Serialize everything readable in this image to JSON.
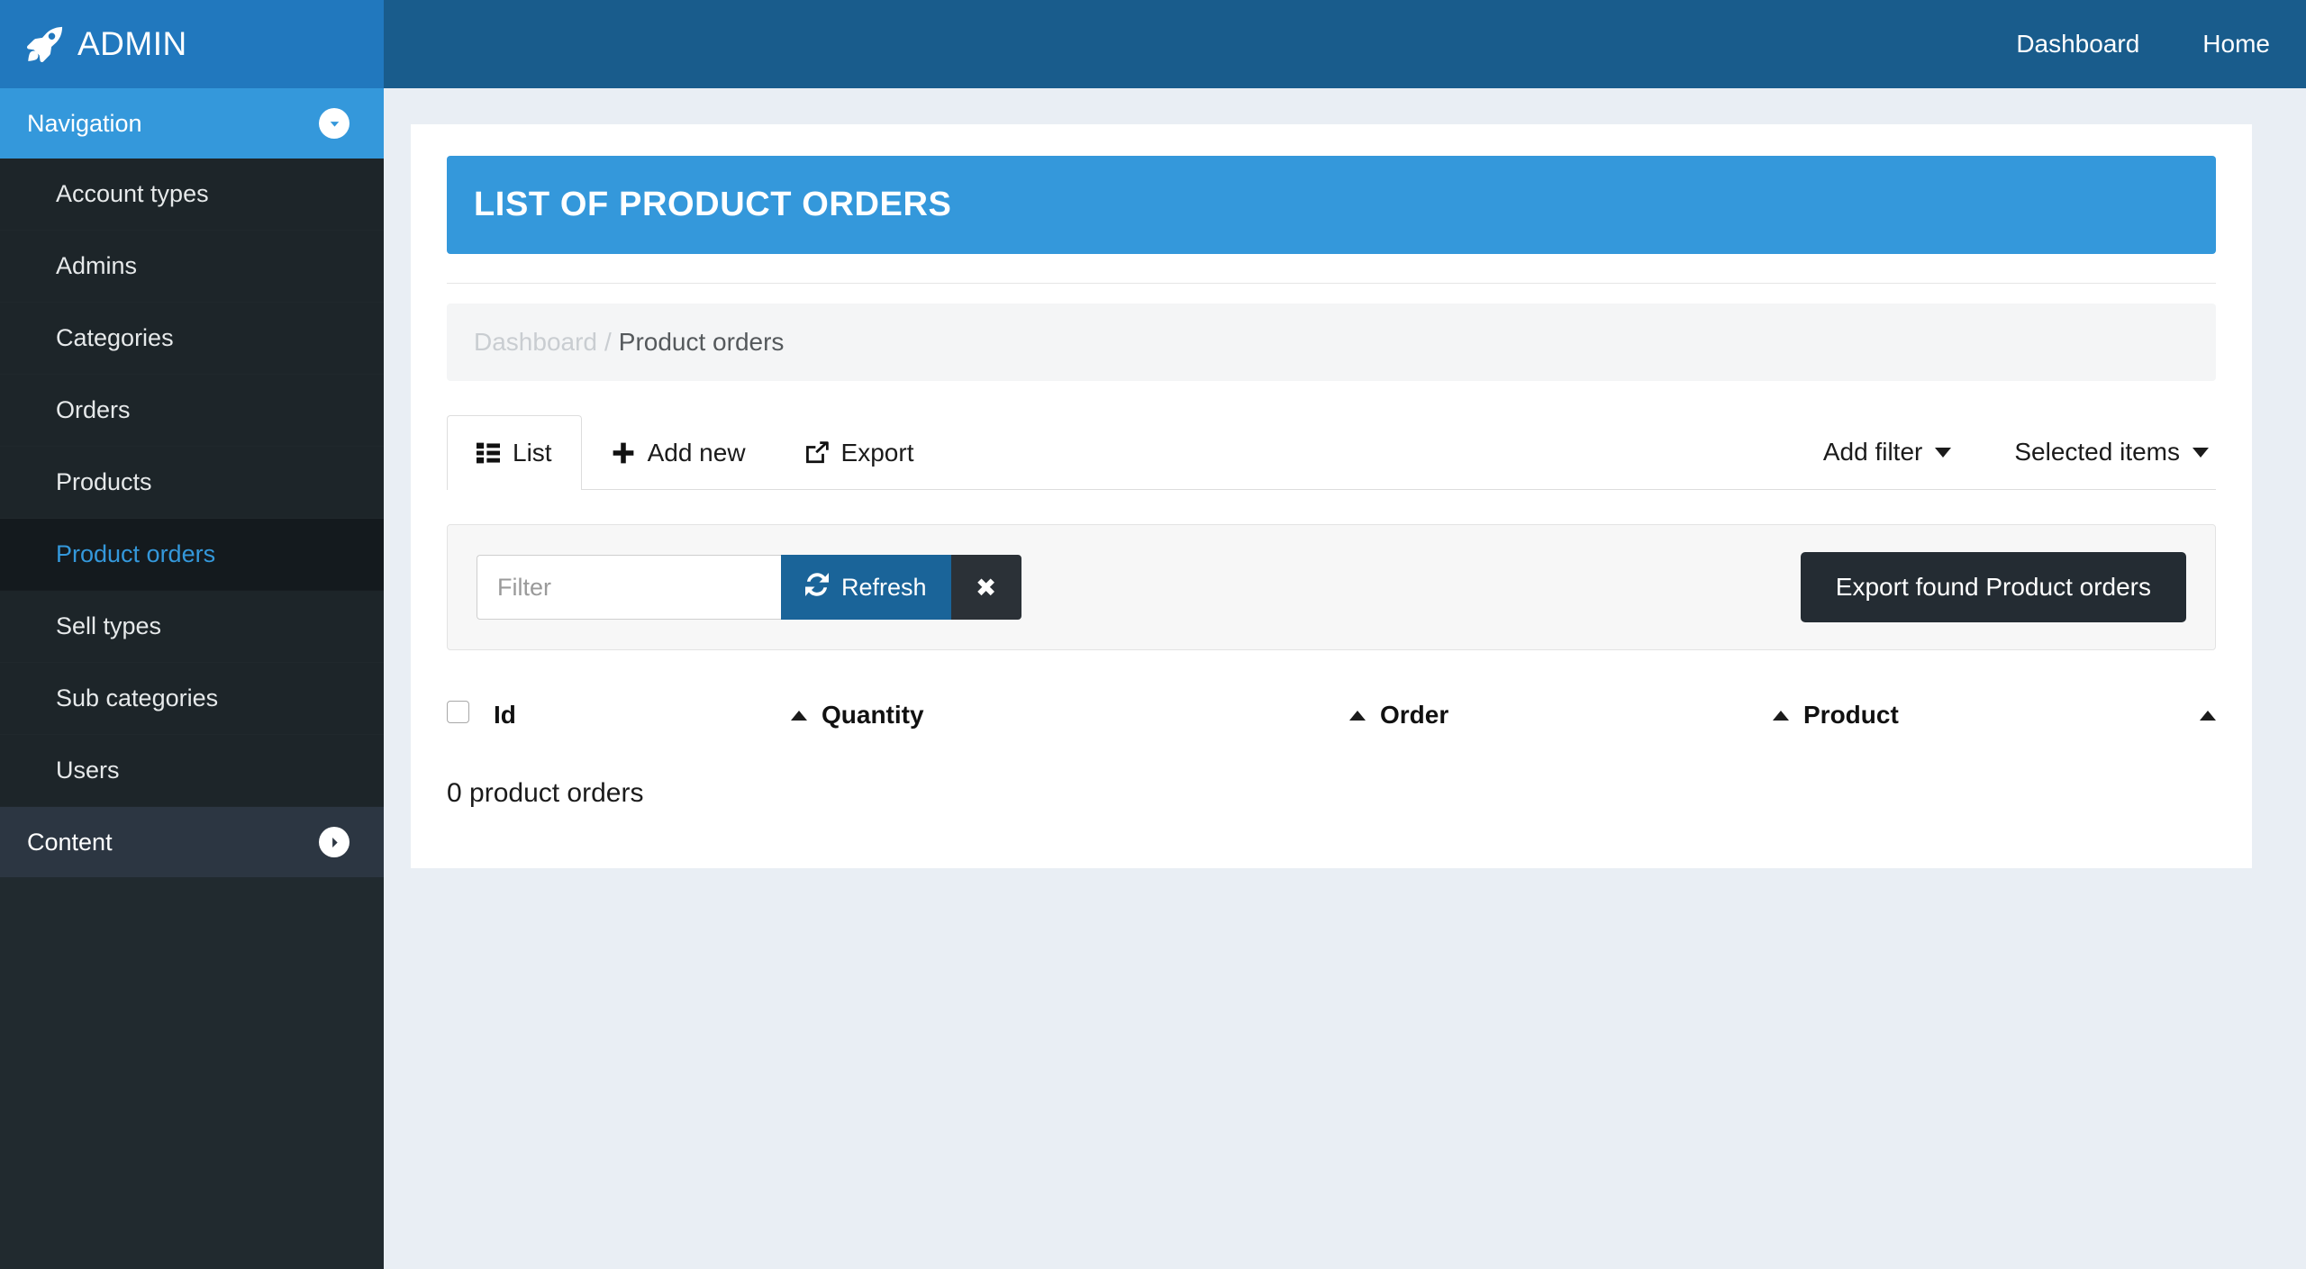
{
  "brand": {
    "name": "ADMIN",
    "icon": "rocket-icon",
    "bg": "#2178be"
  },
  "topbar": {
    "bg": "#195c8c",
    "links": [
      {
        "label": "Dashboard"
      },
      {
        "label": "Home"
      }
    ]
  },
  "sidebar": {
    "bg": "#212a2f",
    "active_color": "#3498db",
    "sections": [
      {
        "title": "Navigation",
        "icon": "chevron-down-circle-icon",
        "expanded": true,
        "accent": "#3498db",
        "items": [
          {
            "label": "Account types",
            "active": false
          },
          {
            "label": "Admins",
            "active": false
          },
          {
            "label": "Categories",
            "active": false
          },
          {
            "label": "Orders",
            "active": false
          },
          {
            "label": "Products",
            "active": false
          },
          {
            "label": "Product orders",
            "active": true
          },
          {
            "label": "Sell types",
            "active": false
          },
          {
            "label": "Sub categories",
            "active": false
          },
          {
            "label": "Users",
            "active": false
          }
        ]
      },
      {
        "title": "Content",
        "icon": "chevron-right-circle-icon",
        "expanded": false,
        "accent": "#2c3642",
        "items": []
      }
    ]
  },
  "page": {
    "title": "LIST OF PRODUCT ORDERS",
    "title_bg": "#3498db",
    "breadcrumb": {
      "root": "Dashboard",
      "separator": "/",
      "current": "Product orders"
    }
  },
  "tabs": [
    {
      "label": "List",
      "icon": "list-icon",
      "active": true
    },
    {
      "label": "Add new",
      "icon": "plus-icon",
      "active": false
    },
    {
      "label": "Export",
      "icon": "share-export-icon",
      "active": false
    }
  ],
  "tab_actions": [
    {
      "label": "Add filter",
      "icon": "caret-down-icon"
    },
    {
      "label": "Selected items",
      "icon": "caret-down-icon"
    }
  ],
  "filter": {
    "placeholder": "Filter",
    "value": "",
    "refresh_label": "Refresh",
    "refresh_icon": "refresh-icon",
    "refresh_bg": "#1a6499",
    "clear_label": "✖",
    "clear_icon": "close-icon",
    "clear_bg": "#2b3137",
    "export_found_label": "Export found Product orders",
    "export_found_bg": "#242c33"
  },
  "table": {
    "columns": [
      {
        "label": "Id",
        "sortable": true
      },
      {
        "label": "Quantity",
        "sortable": true
      },
      {
        "label": "Order",
        "sortable": true
      },
      {
        "label": "Product",
        "sortable": true
      }
    ],
    "rows": [],
    "empty_text": "0 product orders"
  }
}
